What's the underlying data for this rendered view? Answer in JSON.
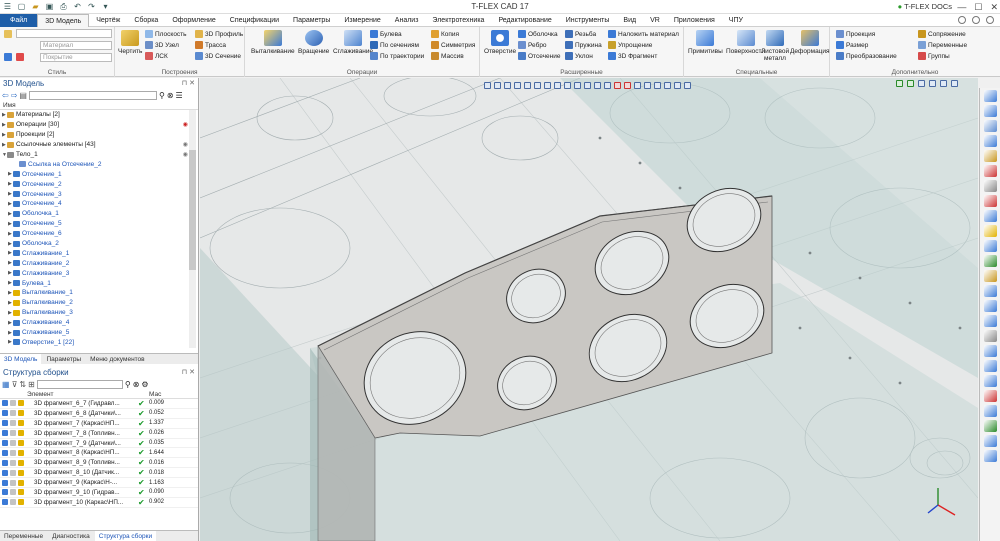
{
  "app": {
    "title": "T-FLEX CAD 17",
    "docs": "T-FLEX DOCs"
  },
  "menu": {
    "tabs": [
      "Файл",
      "3D Модель",
      "Чертёж",
      "Сборка",
      "Оформление",
      "Спецификации",
      "Параметры",
      "Измерение",
      "Анализ",
      "Электротехника",
      "Редактирование",
      "Инструменты",
      "Вид",
      "VR",
      "Приложения",
      "ЧПУ"
    ],
    "active": "3D Модель"
  },
  "ribbon": {
    "style_group": {
      "label": "Стиль",
      "material": "Материал",
      "coating": "Покрытие"
    },
    "construct_group": {
      "label": "Построения",
      "draw": "Чертить",
      "plane": "Плоскость",
      "node": "3D Узел",
      "lsk": "ЛСК",
      "profile": "3D Профиль",
      "path": "Трасса",
      "section": "3D Сечение"
    },
    "ops_group": {
      "label": "Операции",
      "extrude": "Выталкивание",
      "rotate": "Вращение",
      "smooth": "Сглаживание",
      "boolean": "Булева",
      "by_sections": "По сечениям",
      "by_path": "По траектории",
      "copy": "Копия",
      "symmetry": "Симметрия",
      "array": "Массив"
    },
    "ext_group": {
      "label": "Расширенные",
      "hole": "Отверстие",
      "shell": "Оболочка",
      "rib": "Ребро",
      "cut": "Отсечение",
      "thread": "Резьба",
      "spring": "Пружина",
      "draft": "Уклон",
      "apply_material": "Наложить материал",
      "simplify": "Упрощение",
      "fragment": "3D Фрагмент"
    },
    "special_group": {
      "label": "Специальные",
      "primitives": "Примитивы",
      "surfaces": "Поверхности",
      "sheet_metal": "Листовой металл",
      "deform": "Деформация"
    },
    "extra_group": {
      "label": "Дополнительно",
      "projection": "Проекция",
      "dimension": "Размер",
      "transform": "Преобразование",
      "mating": "Сопряжение",
      "variables": "Переменные",
      "groups": "Группы"
    }
  },
  "model_panel": {
    "title": "3D Модель",
    "column": "Имя",
    "tree": [
      {
        "label": "Материалы [2]",
        "blue": false,
        "level": 0,
        "exp": "▶",
        "color": "#d9a33a"
      },
      {
        "label": "Операции [30]",
        "blue": false,
        "level": 0,
        "exp": "▶",
        "color": "#d9a33a"
      },
      {
        "label": "Проекции [2]",
        "blue": false,
        "level": 0,
        "exp": "▶",
        "color": "#d9a33a"
      },
      {
        "label": "Ссылочные элементы [43]",
        "blue": false,
        "level": 0,
        "exp": "▶",
        "color": "#d9a33a"
      },
      {
        "label": "Тело_1",
        "blue": false,
        "level": 0,
        "exp": "▼",
        "color": "#8a8a8a"
      },
      {
        "label": "Ссылка на Отсечение_2",
        "blue": true,
        "level": 2,
        "exp": "",
        "color": "#6b8fcf"
      },
      {
        "label": "Отсечение_1",
        "blue": true,
        "level": 1,
        "exp": "▶",
        "color": "#3a78c9"
      },
      {
        "label": "Отсечение_2",
        "blue": true,
        "level": 1,
        "exp": "▶",
        "color": "#3a78c9"
      },
      {
        "label": "Отсечение_3",
        "blue": true,
        "level": 1,
        "exp": "▶",
        "color": "#3a78c9"
      },
      {
        "label": "Отсечение_4",
        "blue": true,
        "level": 1,
        "exp": "▶",
        "color": "#3a78c9"
      },
      {
        "label": "Оболочка_1",
        "blue": true,
        "level": 1,
        "exp": "▶",
        "color": "#3a78c9"
      },
      {
        "label": "Отсечение_5",
        "blue": true,
        "level": 1,
        "exp": "▶",
        "color": "#3a78c9"
      },
      {
        "label": "Отсечение_6",
        "blue": true,
        "level": 1,
        "exp": "▶",
        "color": "#3a78c9"
      },
      {
        "label": "Оболочка_2",
        "blue": true,
        "level": 1,
        "exp": "▶",
        "color": "#3a78c9"
      },
      {
        "label": "Сглаживание_1",
        "blue": true,
        "level": 1,
        "exp": "▶",
        "color": "#3a78c9"
      },
      {
        "label": "Сглаживание_2",
        "blue": true,
        "level": 1,
        "exp": "▶",
        "color": "#3a78c9"
      },
      {
        "label": "Сглаживание_3",
        "blue": true,
        "level": 1,
        "exp": "▶",
        "color": "#3a78c9"
      },
      {
        "label": "Булева_1",
        "blue": true,
        "level": 1,
        "exp": "▶",
        "color": "#3a78c9"
      },
      {
        "label": "Выталкивание_1",
        "blue": true,
        "level": 1,
        "exp": "▶",
        "color": "#e2b200"
      },
      {
        "label": "Выталкивание_2",
        "blue": true,
        "level": 1,
        "exp": "▶",
        "color": "#e2b200"
      },
      {
        "label": "Выталкивание_3",
        "blue": true,
        "level": 1,
        "exp": "▶",
        "color": "#e2b200"
      },
      {
        "label": "Сглаживание_4",
        "blue": true,
        "level": 1,
        "exp": "▶",
        "color": "#3a78c9"
      },
      {
        "label": "Сглаживание_5",
        "blue": true,
        "level": 1,
        "exp": "▶",
        "color": "#3a78c9"
      },
      {
        "label": "Отверстие_1 [22]",
        "blue": true,
        "level": 1,
        "exp": "▶",
        "color": "#3a78c9"
      }
    ],
    "tabs": [
      "3D Модель",
      "Параметры",
      "Меню документов"
    ]
  },
  "assembly_panel": {
    "title": "Структура сборки",
    "col_element": "Элемент",
    "col_mass": "Мас",
    "rows": [
      {
        "name": "3D фрагмент_6_7 (Гидравл...",
        "mass": "0.009"
      },
      {
        "name": "3D фрагмент_6_8 (Датчики\\...",
        "mass": "0.052"
      },
      {
        "name": "3D фрагмент_7 (Каркас\\НП...",
        "mass": "1.337"
      },
      {
        "name": "3D фрагмент_7_8 (Топливн...",
        "mass": "0.026"
      },
      {
        "name": "3D фрагмент_7_9 (Датчики\\...",
        "mass": "0.035"
      },
      {
        "name": "3D фрагмент_8 (Каркас\\НП...",
        "mass": "1.644"
      },
      {
        "name": "3D фрагмент_8_9 (Топливн...",
        "mass": "0.016"
      },
      {
        "name": "3D фрагмент_8_10 (Датчик...",
        "mass": "0.018"
      },
      {
        "name": "3D фрагмент_9 (Каркас\\Н-...",
        "mass": "1.163"
      },
      {
        "name": "3D фрагмент_9_10 (Гидрав...",
        "mass": "0.090"
      },
      {
        "name": "3D фрагмент_10 (Каркас\\НП...",
        "mass": "0.902"
      }
    ],
    "tabs": [
      "Переменные",
      "Диагностика",
      "Структура сборки"
    ]
  },
  "colors": {
    "file_tab": "#1e5ea8",
    "tree_blue": "#1d55b8",
    "check_green": "#1b9a2b",
    "plate": "#c9c7c3"
  }
}
